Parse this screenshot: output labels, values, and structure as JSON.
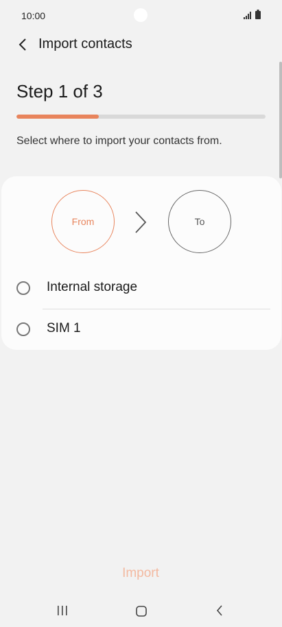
{
  "status_bar": {
    "time": "10:00",
    "icons": [
      "signal-icon",
      "battery-icon"
    ]
  },
  "header": {
    "title": "Import contacts",
    "back_icon": "chevron-left-icon"
  },
  "step": {
    "title": "Step 1 of 3",
    "progress": 0.33
  },
  "instruction": "Select where to import your contacts from.",
  "flow": {
    "from_label": "From",
    "to_label": "To",
    "separator_icon": "chevron-right-icon"
  },
  "options": [
    {
      "label": "Internal storage",
      "selected": false
    },
    {
      "label": "SIM 1",
      "selected": false
    }
  ],
  "actions": {
    "import_label": "Import",
    "import_enabled": false
  },
  "nav": {
    "icons": [
      "recents-icon",
      "home-icon",
      "back-icon"
    ]
  },
  "colors": {
    "accent": "#e8845c",
    "accent_disabled": "#f3b9a0",
    "background": "#f2f2f2"
  }
}
